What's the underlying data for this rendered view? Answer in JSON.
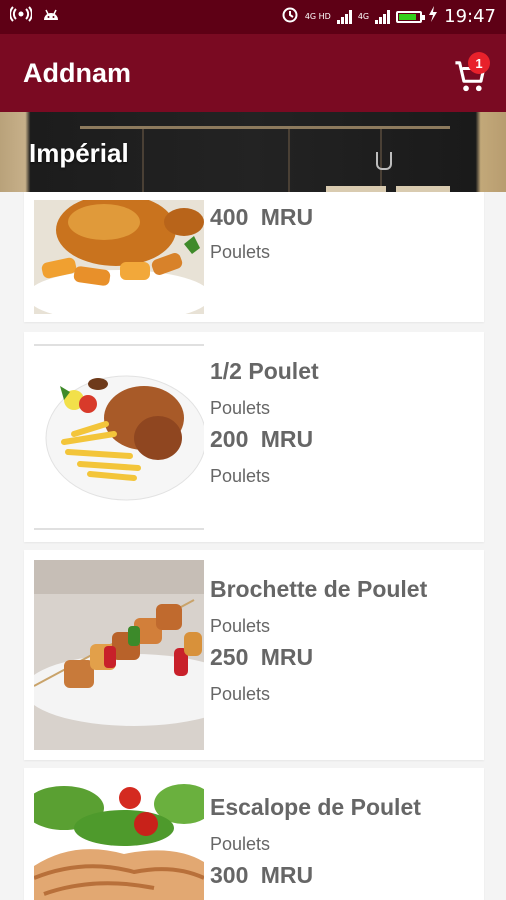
{
  "status_bar": {
    "left_icons": [
      "hotspot-icon",
      "android-icon"
    ],
    "network_label_1": "4G HD",
    "network_label_2": "4G",
    "time": "19:47",
    "battery_level": 0.85
  },
  "app_bar": {
    "title": "Addnam",
    "cart_count": "1",
    "cart_icon": "cart-icon"
  },
  "banner": {
    "title": "Impérial"
  },
  "items": [
    {
      "name": "",
      "category_1": "",
      "price": "400  MRU",
      "category_2": "Poulets",
      "image": "roast-chicken-with-potatoes"
    },
    {
      "name": "1/2 Poulet",
      "category_1": "Poulets",
      "price": "200  MRU",
      "category_2": "Poulets",
      "image": "half-chicken-with-fries"
    },
    {
      "name": "Brochette de Poulet",
      "category_1": "Poulets",
      "price": "250  MRU",
      "category_2": "Poulets",
      "image": "chicken-skewers"
    },
    {
      "name": "Escalope de Poulet",
      "category_1": "Poulets",
      "price": "300  MRU",
      "category_2": "",
      "image": "grilled-chicken-escalope-with-salad"
    }
  ],
  "colors": {
    "status_bar": "#5e0015",
    "app_bar": "#7a0a22",
    "badge": "#e8212b",
    "text": "#666666"
  }
}
